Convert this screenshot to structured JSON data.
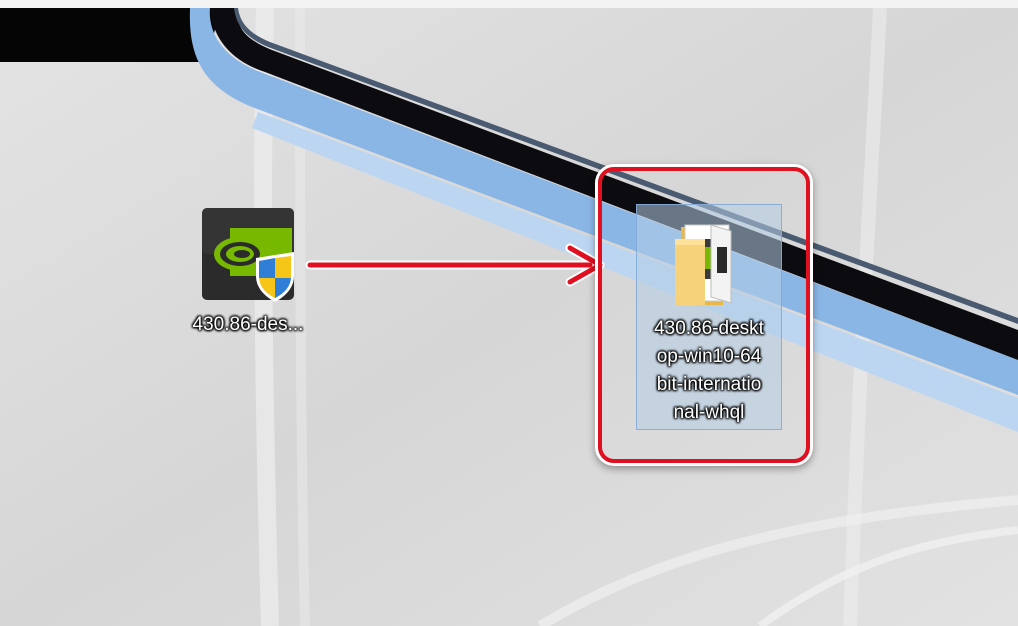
{
  "desktop": {
    "icons": [
      {
        "label": "430.86-des...",
        "icon": "nvidia-installer-with-uac-shield-icon"
      },
      {
        "label_lines": [
          "430.86-deskt",
          "op-win10-64",
          "bit-internatio",
          "nal-whql"
        ],
        "icon": "folder-icon",
        "selected": true
      }
    ]
  },
  "annotations": {
    "highlight_color": "#e01020",
    "arrow_color": "#e01020"
  }
}
